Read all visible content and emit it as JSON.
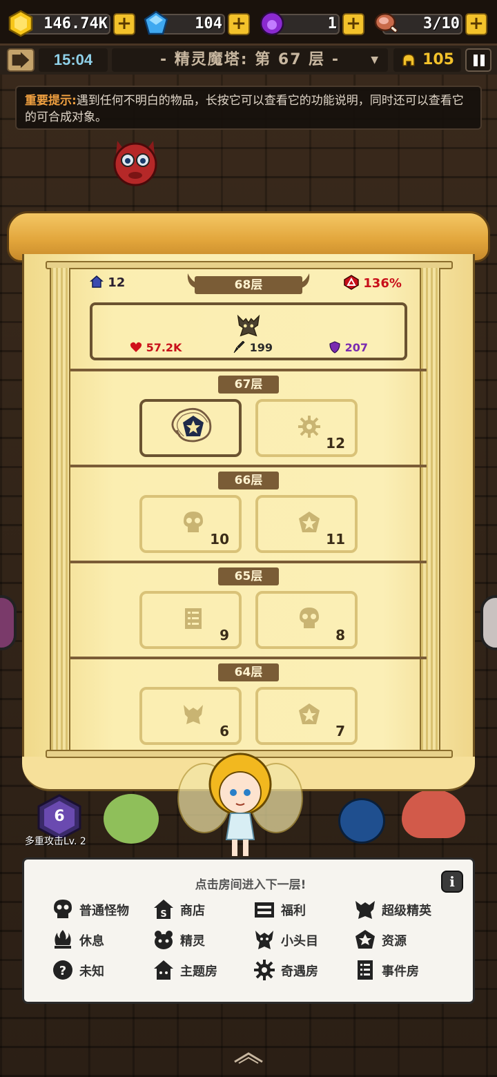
{
  "resources": {
    "gold": "146.74K",
    "gems": "104",
    "orbs": "1",
    "stamina": "3/10",
    "plus": "+"
  },
  "bar2": {
    "timer": "15:04",
    "floor_title": "- 精灵魔塔: 第 67 层 -",
    "power": "105"
  },
  "tip": {
    "head": "重要提示:",
    "text": "遇到任何不明白的物品，长按它可以查看它的功能说明，同时还可以查看它的可合成对象。"
  },
  "skill": {
    "count": "6",
    "label": "多重攻击Lv. 2"
  },
  "tower": {
    "top_left_value": "12",
    "top_right_value": "136%",
    "boss_floor": {
      "label": "68层",
      "hp": "57.2K",
      "attack": "199",
      "defense": "207"
    },
    "floors": [
      {
        "label": "67层",
        "rooms": [
          {
            "icon": "resource-icon",
            "num": "",
            "current": true
          },
          {
            "icon": "adventure-icon",
            "num": "12"
          }
        ]
      },
      {
        "label": "66层",
        "rooms": [
          {
            "icon": "skull-icon",
            "num": "10"
          },
          {
            "icon": "resource-icon",
            "num": "11"
          }
        ]
      },
      {
        "label": "65层",
        "rooms": [
          {
            "icon": "event-icon",
            "num": "9"
          },
          {
            "icon": "skull-icon",
            "num": "8"
          }
        ]
      },
      {
        "label": "64层",
        "rooms": [
          {
            "icon": "miniboss-icon",
            "num": "6"
          },
          {
            "icon": "resource-icon",
            "num": "7"
          }
        ]
      }
    ]
  },
  "legend": {
    "title": "点击房间进入下一层!",
    "info": "i",
    "items": [
      {
        "icon": "skull-icon",
        "label": "普通怪物"
      },
      {
        "icon": "shop-icon",
        "label": "商店"
      },
      {
        "icon": "welfare-icon",
        "label": "福利"
      },
      {
        "icon": "super-elite-icon",
        "label": "超级精英"
      },
      {
        "icon": "rest-icon",
        "label": "休息"
      },
      {
        "icon": "spirit-icon",
        "label": "精灵"
      },
      {
        "icon": "miniboss-icon",
        "label": "小头目"
      },
      {
        "icon": "resource-icon",
        "label": "资源"
      },
      {
        "icon": "unknown-icon",
        "label": "未知"
      },
      {
        "icon": "theme-room-icon",
        "label": "主题房"
      },
      {
        "icon": "adventure-icon",
        "label": "奇遇房"
      },
      {
        "icon": "event-icon",
        "label": "事件房"
      }
    ]
  },
  "colors": {
    "accent_gold": "#f3c22b",
    "timer_blue": "#8fd0e8",
    "tip_orange": "#f0a040",
    "hp_red": "#c8101a",
    "defense_purple": "#7a2ab0"
  }
}
